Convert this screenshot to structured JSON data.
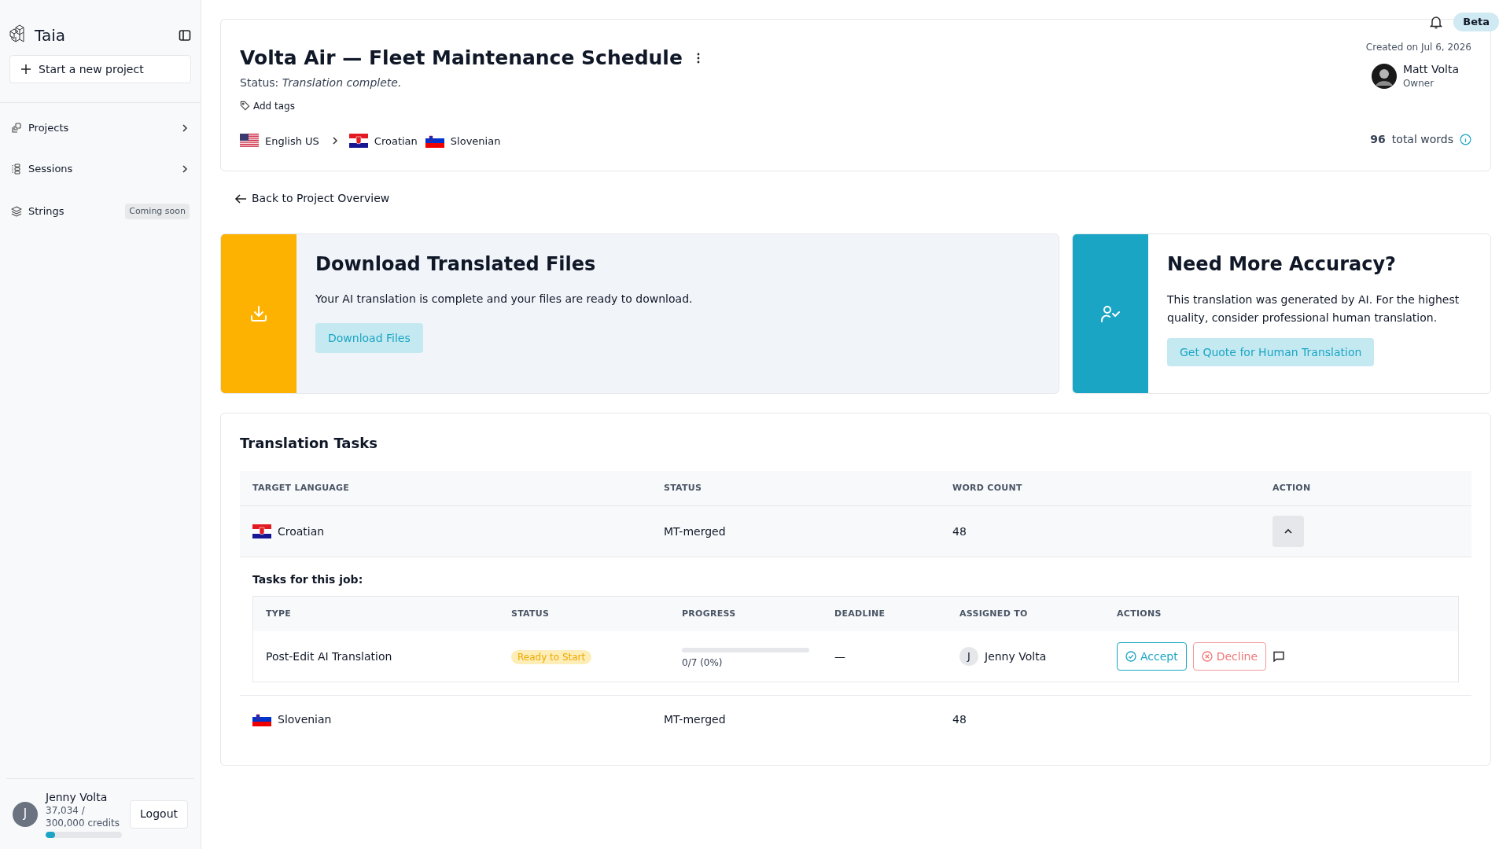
{
  "sidebar": {
    "brand": "Taia",
    "new_project": "Start a new project",
    "items": [
      {
        "label": "Projects",
        "kind": "chevron"
      },
      {
        "label": "Sessions",
        "kind": "chevron"
      },
      {
        "label": "Strings",
        "kind": "badge",
        "badge": "Coming soon"
      }
    ],
    "user": {
      "initial": "J",
      "name": "Jenny Volta",
      "credits": "37,034 / 300,000 credits",
      "level": 0.123
    },
    "logout": "Logout"
  },
  "topbar": {
    "badge": "Beta"
  },
  "project": {
    "title": "Volta Air — Fleet Maintenance Schedule",
    "status_label": "Status:",
    "status": "Translation complete.",
    "add_tags": "Add tags",
    "source": {
      "name": "English US",
      "kind": "us"
    },
    "targets": [
      {
        "name": "Croatian",
        "kind": "hr"
      },
      {
        "name": "Slovenian",
        "kind": "si"
      }
    ],
    "created": "Created on Jul 6, 2026",
    "owner": {
      "name": "Matt Volta",
      "role": "Owner"
    },
    "word_count": "96",
    "word_label": "total words"
  },
  "back_link": "Back to Project Overview",
  "download_card": {
    "title": "Download Translated Files",
    "text": "Your AI translation is complete and your files are ready to download.",
    "button": "Download Files"
  },
  "accuracy_card": {
    "title": "Need More Accuracy?",
    "text": "This translation was generated by AI. For the highest quality, consider professional human translation.",
    "button": "Get Quote for Human Translation"
  },
  "tasks": {
    "title": "Translation Tasks",
    "columns": [
      "TARGET LANGUAGE",
      "STATUS",
      "WORD COUNT",
      "ACTION"
    ],
    "rows": [
      {
        "language": "Croatian",
        "kind": "hr",
        "status": "MT-merged",
        "word_count": "48",
        "expanded": true
      },
      {
        "language": "Slovenian",
        "kind": "si",
        "status": "MT-merged",
        "word_count": "48",
        "expanded": false
      }
    ],
    "subtasks": {
      "title": "Tasks for this job:",
      "columns": [
        "TYPE",
        "STATUS",
        "PROGRESS",
        "DEADLINE",
        "ASSIGNED TO",
        "ACTIONS"
      ],
      "rows": [
        {
          "type": "Post-Edit AI Translation",
          "status": "Ready to Start",
          "level": 0,
          "progress": "0/7 (0%)",
          "deadline": "—",
          "assignee_initial": "J",
          "assignee": "Jenny Volta",
          "accept": "Accept",
          "decline": "Decline"
        }
      ]
    }
  }
}
